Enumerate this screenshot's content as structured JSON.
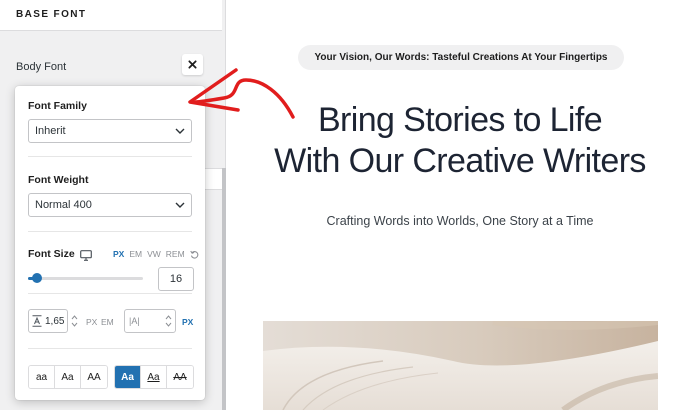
{
  "sidebar": {
    "section_title": "BASE FONT",
    "body_font_label": "Body Font",
    "close_icon": "close-icon"
  },
  "popover": {
    "font_family": {
      "label": "Font Family",
      "value": "Inherit"
    },
    "font_weight": {
      "label": "Font Weight",
      "value": "Normal 400"
    },
    "font_size": {
      "label": "Font Size",
      "device_icon": "monitor-icon",
      "units": [
        "PX",
        "EM",
        "VW",
        "REM"
      ],
      "active_unit": "PX",
      "value": "16",
      "slider_percent": 8
    },
    "line_height": {
      "value": "1,65",
      "units": [
        "PX",
        "EM"
      ]
    },
    "letter_spacing": {
      "placeholder": "|A|",
      "unit": "PX"
    },
    "text_case": [
      "aa",
      "Aa",
      "AA"
    ],
    "text_decoration": [
      "Aa",
      "Aa",
      "AA"
    ],
    "active_decoration_index": 0
  },
  "preview": {
    "tagline": "Your Vision, Our Words: Tasteful Creations At Your Fingertips",
    "headline_line1": "Bring Stories to Life",
    "headline_line2": "With Our Creative Writers",
    "subheading": "Crafting Words into Worlds, One Story at a Time"
  },
  "colors": {
    "accent": "#2271b1",
    "annotation_arrow": "#e11d1d",
    "headline": "#1d2433"
  }
}
